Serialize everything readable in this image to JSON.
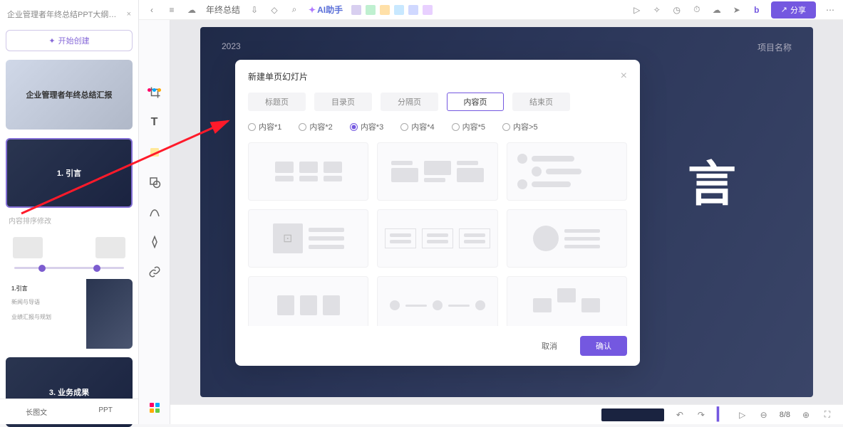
{
  "document": {
    "title": "企业管理者年终总结PPT大纲…",
    "new_btn_label": "开始创建"
  },
  "left_panel": {
    "thumb1_title": "企业管理者年终总结汇报",
    "thumb2_title": "1. 引言",
    "section_label": "内容排序修改",
    "split_line1": "1.引言",
    "split_line2": "新闻与导语",
    "split_line3": "业绩汇报与规划",
    "thumb4_title": "3. 业务成果",
    "tab1": "长图文",
    "tab2": "PPT"
  },
  "top_bar": {
    "doc_name": "年终总结",
    "ai_label": "AI助手"
  },
  "top_right": {
    "share_label": "分享"
  },
  "canvas": {
    "year": "2023",
    "project": "项目名称",
    "big_text": "言"
  },
  "bottom_status": {
    "page_info": "8/8"
  },
  "modal": {
    "title": "新建单页幻灯片",
    "tabs": [
      "标题页",
      "目录页",
      "分隔页",
      "内容页",
      "结束页"
    ],
    "active_tab_index": 3,
    "radios": [
      "内容*1",
      "内容*2",
      "内容*3",
      "内容*4",
      "内容*5",
      "内容>5"
    ],
    "active_radio_index": 2,
    "cancel_label": "取消",
    "confirm_label": "确认"
  }
}
